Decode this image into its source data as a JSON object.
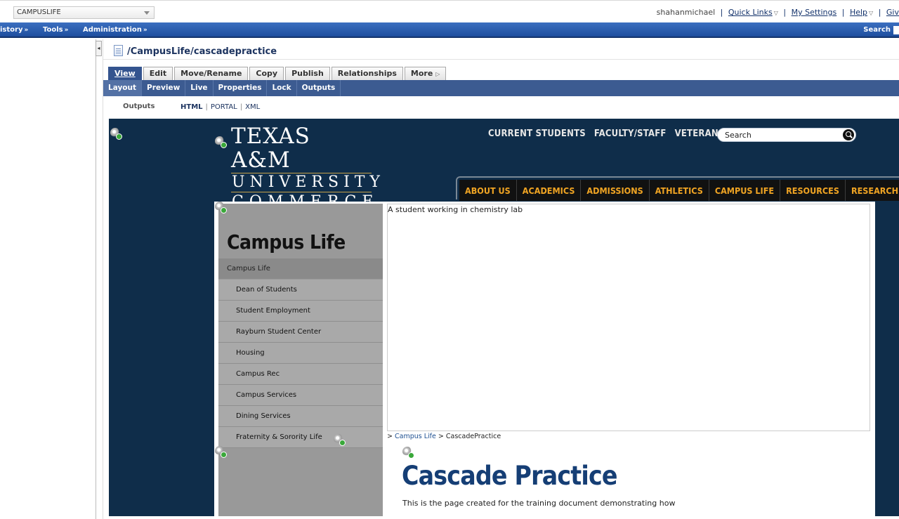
{
  "site_select": {
    "value": "CAMPUSLIFE"
  },
  "user_bar": {
    "username": "shahanmichael",
    "quick_links": "Quick Links",
    "my_settings": "My Settings",
    "help": "Help",
    "give": "Giv"
  },
  "navbar": {
    "items": [
      "istory",
      "Tools",
      "Administration"
    ],
    "search": "Search"
  },
  "asset": {
    "path": "/CampusLife/cascadepractice"
  },
  "tabs": [
    "View",
    "Edit",
    "Move/Rename",
    "Copy",
    "Publish",
    "Relationships",
    "More"
  ],
  "subtabs": [
    "Layout",
    "Preview",
    "Live",
    "Properties",
    "Lock",
    "Outputs"
  ],
  "outputs": {
    "label": "Outputs",
    "html": "HTML",
    "portal": "PORTAL",
    "xml": "XML"
  },
  "preview": {
    "logo": {
      "line1": "TEXAS A&M",
      "line2": "UNIVERSITY",
      "line3": "COMMERCE"
    },
    "top_links": [
      "CURRENT STUDENTS",
      "FACULTY/STAFF",
      "VETERANS"
    ],
    "search_placeholder": "Search",
    "main_nav": [
      "ABOUT US",
      "ACADEMICS",
      "ADMISSIONS",
      "ATHLETICS",
      "CAMPUS LIFE",
      "RESOURCES",
      "RESEARCH"
    ],
    "left_nav": {
      "title": "Campus Life",
      "current": "Campus Life",
      "items": [
        "Dean of Students",
        "Student Employment",
        "Rayburn Student Center",
        "Housing",
        "Campus Rec",
        "Campus Services",
        "Dining Services",
        "Fraternity & Sorority Life"
      ]
    },
    "hero_alt": "A student working in chemistry lab",
    "breadcrumb": {
      "prefix": ">",
      "link": "Campus Life",
      "sep": ">",
      "current": "CascadePractice"
    },
    "article": {
      "title": "Cascade Practice",
      "body": "This is the page created for the training document demonstrating how"
    }
  },
  "colors": {
    "brand_navy": "#0f2d4a",
    "nav_gold": "#f0a423",
    "cms_blue": "#3c5b91"
  }
}
